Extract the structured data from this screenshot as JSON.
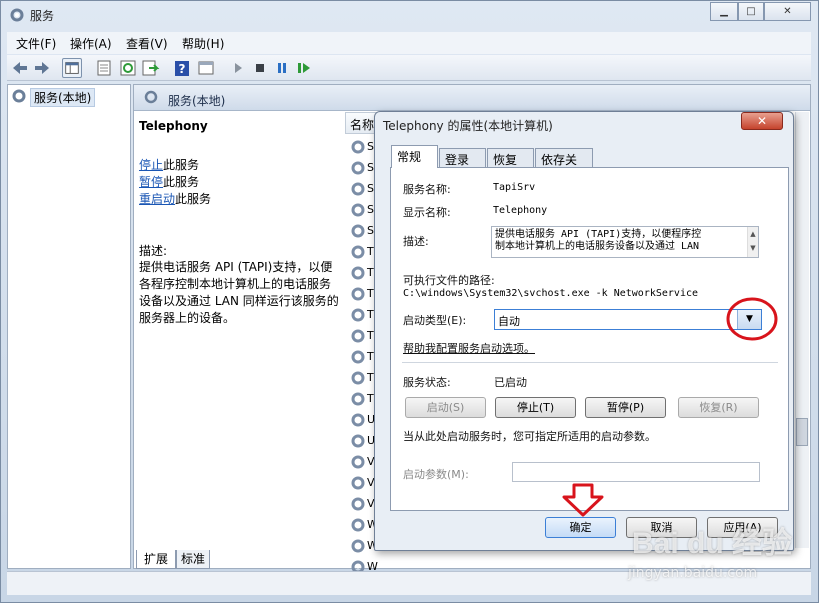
{
  "window": {
    "title": "服务",
    "min": "▁",
    "max": "□",
    "close": "✕"
  },
  "menu": [
    "文件(F)",
    "操作(A)",
    "查看(V)",
    "帮助(H)"
  ],
  "tree": {
    "root": "服务(本地)"
  },
  "header": {
    "title": "服务(本地)",
    "col_name": "名称"
  },
  "detail": {
    "service_title": "Telephony",
    "actions": [
      {
        "link": "停止",
        "rest": "此服务"
      },
      {
        "link": "暂停",
        "rest": "此服务"
      },
      {
        "link": "重启动",
        "rest": "此服务"
      }
    ],
    "desc_label": "描述:",
    "desc_lines": [
      "提供电话服务 API (TAPI)支持，以便",
      "各程序控制本地计算机上的电话服务",
      "设备以及通过 LAN 同样运行该服务的",
      "服务器上的设备。"
    ]
  },
  "service_rows": [
    "S",
    "S",
    "S",
    "S",
    "S",
    "T",
    "T",
    "T",
    "T",
    "T",
    "T",
    "T",
    "T",
    "U",
    "U",
    "V",
    "V",
    "V",
    "W",
    "W",
    "W",
    "W"
  ],
  "bottom_tabs": [
    "扩展",
    "标准"
  ],
  "dialog": {
    "title": "Telephony 的属性(本地计算机)",
    "close": "✕",
    "tabs": [
      "常规",
      "登录",
      "恢复",
      "依存关系"
    ],
    "service_name_label": "服务名称:",
    "service_name": "TapiSrv",
    "display_name_label": "显示名称:",
    "display_name": "Telephony",
    "desc_label": "描述:",
    "desc_lines": [
      "提供电话服务 API (TAPI)支持，以便程序控",
      "制本地计算机上的电话服务设备以及通过 LAN"
    ],
    "path_label": "可执行文件的路径:",
    "path": "C:\\windows\\System32\\svchost.exe -k NetworkService",
    "startup_label": "启动类型(E):",
    "startup_value": "自动",
    "help_link": "帮助我配置服务启动选项。",
    "status_label": "服务状态:",
    "status_value": "已启动",
    "btn_start": "启动(S)",
    "btn_stop": "停止(T)",
    "btn_pause": "暂停(P)",
    "btn_resume": "恢复(R)",
    "hint": "当从此处启动服务时，您可指定所适用的启动参数。",
    "param_label": "启动参数(M):",
    "param_value": "",
    "btn_ok": "确定",
    "btn_cancel": "取消",
    "btn_apply": "应用(A)"
  },
  "watermark": {
    "brand": "Bai du 经验",
    "url": "jingyan.baidu.com"
  },
  "colors": {
    "annotation_red": "#d8141c",
    "link": "#1a56b4",
    "dropdown_blue": "#3c7fd6"
  }
}
